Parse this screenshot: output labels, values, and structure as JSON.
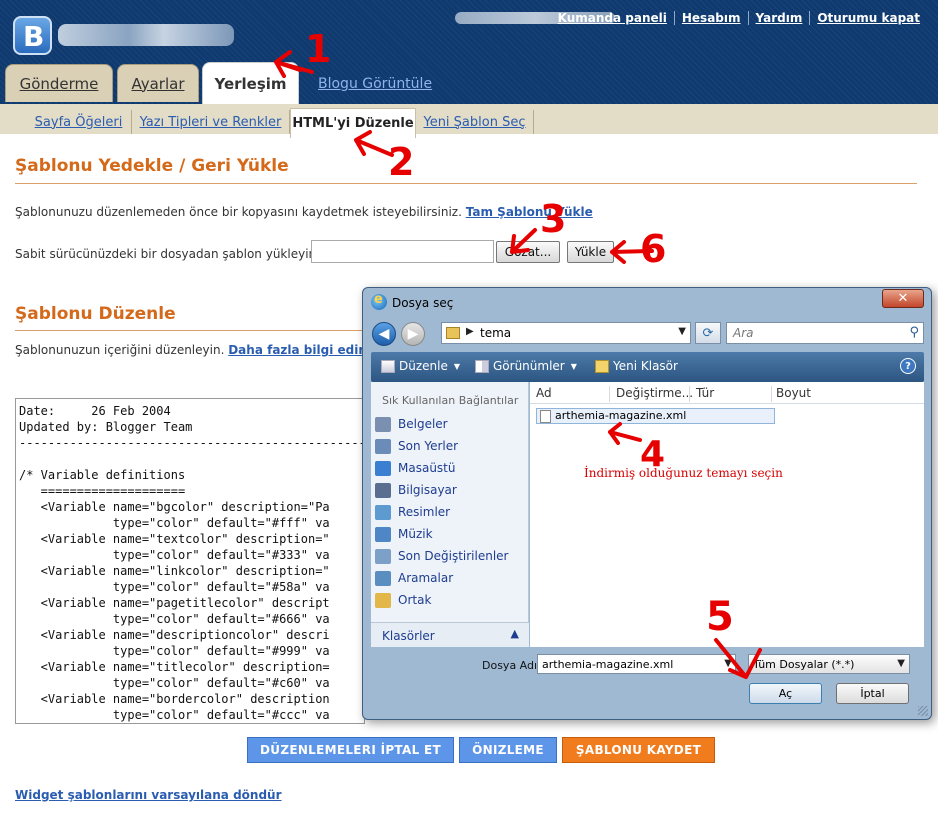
{
  "header": {
    "logo_letter": "B",
    "links": [
      "Kumanda paneli",
      "Hesabım",
      "Yardım",
      "Oturumu kapat"
    ],
    "tabs": [
      {
        "label": "Gönderme",
        "active": false
      },
      {
        "label": "Ayarlar",
        "active": false
      },
      {
        "label": "Yerleşim",
        "active": true
      }
    ],
    "view_blog": "Blogu Görüntüle"
  },
  "subnav": {
    "tabs": [
      {
        "label": "Sayfa Öğeleri",
        "active": false
      },
      {
        "label": "Yazı Tipleri ve Renkler",
        "active": false
      },
      {
        "label": "HTML'yi Düzenle",
        "active": true
      },
      {
        "label": "Yeni Şablon Seç",
        "active": false
      }
    ]
  },
  "backup": {
    "title": "Şablonu Yedekle / Geri Yükle",
    "text": "Şablonunuzu düzenlemeden önce bir kopyasını kaydetmek isteyebilirsiniz.",
    "download_link": "Tam Şablonu Yükle",
    "upload_text": "Sabit sürücünüzdeki bir dosyadan şablon yükleyin:",
    "browse_label": "Gözat...",
    "upload_label": "Yükle"
  },
  "edit": {
    "title": "Şablonu Düzenle",
    "text": "Şablonunuzun içeriğini düzenleyin.",
    "more_link": "Daha fazla bilgi edinin",
    "code": "Date:     26 Feb 2004\nUpdated by: Blogger Team\n----------------------------------------------------------------\n\n/* Variable definitions\n   ====================\n   <Variable name=\"bgcolor\" description=\"Pa\n             type=\"color\" default=\"#fff\" va\n   <Variable name=\"textcolor\" description=\"\n             type=\"color\" default=\"#333\" va\n   <Variable name=\"linkcolor\" description=\"\n             type=\"color\" default=\"#58a\" va\n   <Variable name=\"pagetitlecolor\" descript\n             type=\"color\" default=\"#666\" va\n   <Variable name=\"descriptioncolor\" descri\n             type=\"color\" default=\"#999\" va\n   <Variable name=\"titlecolor\" description=\n             type=\"color\" default=\"#c60\" va\n   <Variable name=\"bordercolor\" description\n             type=\"color\" default=\"#ccc\" va"
  },
  "actions": {
    "cancel": "DÜZENLEMELERI İPTAL ET",
    "preview": "ÖNIZLEME",
    "save": "ŞABLONU KAYDET",
    "revert": "Widget şablonlarını varsayılana döndür"
  },
  "dialog": {
    "title": "Dosya seç",
    "close": "✕",
    "address": "tema",
    "search_placeholder": "Ara",
    "toolbar": {
      "organize": "Düzenle",
      "views": "Görünümler",
      "new_folder": "Yeni Klasör"
    },
    "nav_header": "Sık Kullanılan Bağlantılar",
    "nav_items": [
      {
        "label": "Belgeler",
        "color": "#7b8fb0"
      },
      {
        "label": "Son Yerler",
        "color": "#6b8cb8"
      },
      {
        "label": "Masaüstü",
        "color": "#3a7fd0"
      },
      {
        "label": "Bilgisayar",
        "color": "#5a6f8f"
      },
      {
        "label": "Resimler",
        "color": "#5c9ad0"
      },
      {
        "label": "Müzik",
        "color": "#4f86c6"
      },
      {
        "label": "Son Değiştirilenler",
        "color": "#7da0c8"
      },
      {
        "label": "Aramalar",
        "color": "#5b8ec0"
      },
      {
        "label": "Ortak",
        "color": "#e3b64a"
      }
    ],
    "folders_label": "Klasörler",
    "columns": [
      "Ad",
      "Değiştirme...",
      "Tür",
      "Boyut"
    ],
    "file": "arthemia-magazine.xml",
    "note": "İndirmiş olduğunuz temayı seçin",
    "filename_label": "Dosya Adı:",
    "filename_value": "arthemia-magazine.xml",
    "filetype_value": "Tüm Dosyalar (*.*)",
    "open": "Aç",
    "cancel": "İptal"
  },
  "annotations": [
    "1",
    "2",
    "3",
    "4",
    "5",
    "6"
  ],
  "colors": {
    "header_bg": "#0f3a70",
    "heading": "#d4691a",
    "link": "#2a5db0",
    "save": "#f07c1e",
    "blue_btn": "#5d95e8",
    "annotation": "#e60000"
  }
}
